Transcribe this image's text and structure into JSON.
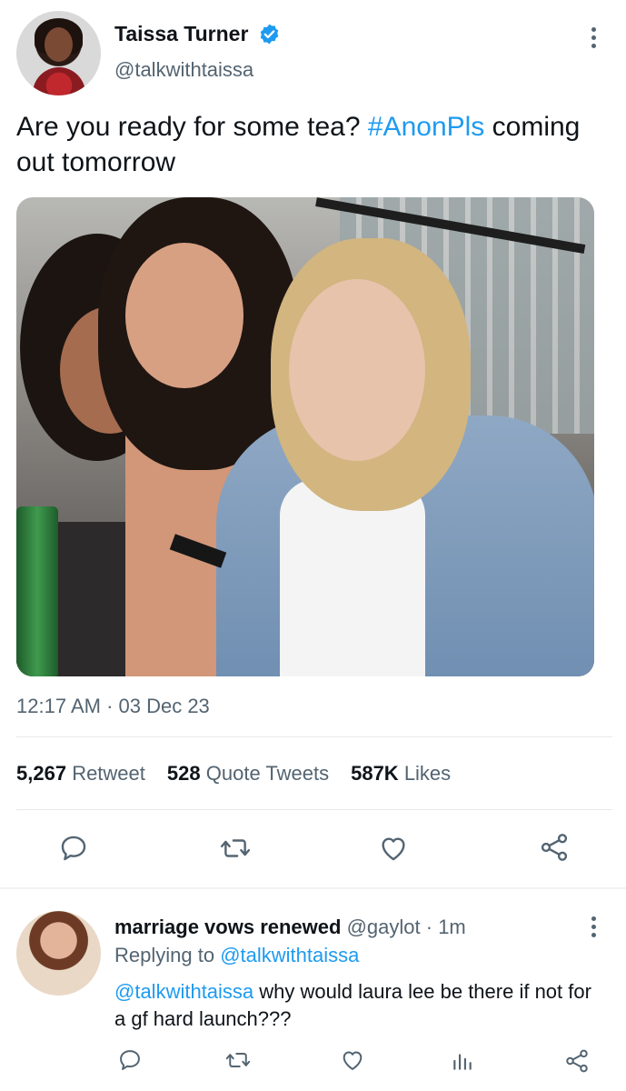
{
  "tweet": {
    "author_name": "Taissa Turner",
    "author_handle": "@talkwithtaissa",
    "text_before": "Are you ready for some tea? ",
    "hashtag": "#AnonPls",
    "text_after": " coming out tomorrow",
    "timestamp": "12:17 AM · 03 Dec 23",
    "stats": {
      "retweets": "5,267",
      "retweets_label": "Retweet",
      "quotes": "528",
      "quotes_label": "Quote Tweets",
      "likes": "587K",
      "likes_label": "Likes"
    }
  },
  "reply": {
    "author_name": "marriage vows renewed",
    "author_handle": "@gaylot",
    "time": "· 1m",
    "replying_prefix": "Replying to",
    "replying_to": "@talkwithtaissa",
    "mention": "@talkwithtaissa",
    "text": " why would laura lee be there if not for a gf hard launch???"
  },
  "colors": {
    "accent": "#1d9bf0",
    "secondary_text": "#536471",
    "primary_text": "#0f1419"
  },
  "icons": {
    "reply": "comment-icon",
    "retweet": "retweet-icon",
    "like": "heart-icon",
    "share": "share-icon",
    "analytics": "analytics-icon",
    "more": "more-vertical-icon",
    "verified": "verified-badge-icon"
  }
}
